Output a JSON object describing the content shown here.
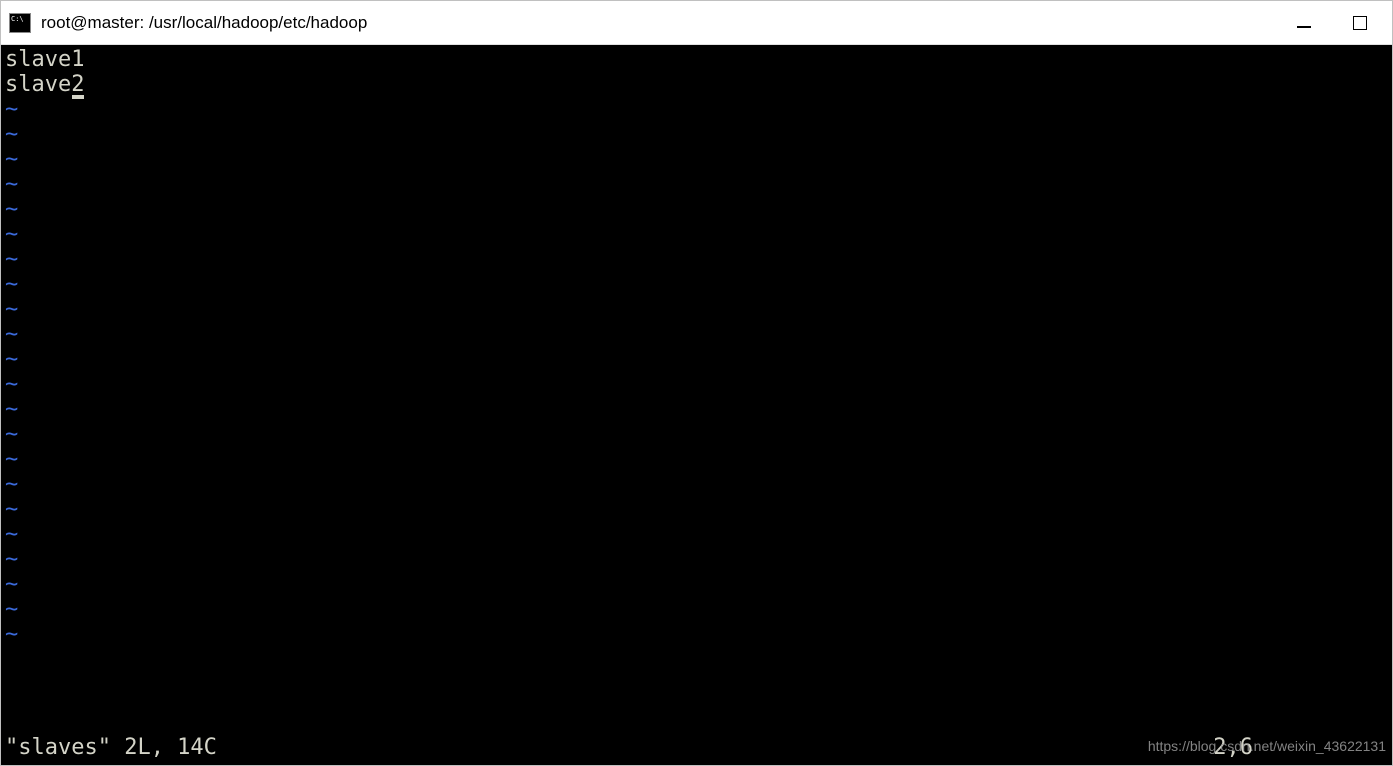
{
  "window": {
    "title": "root@master: /usr/local/hadoop/etc/hadoop"
  },
  "editor": {
    "lines": [
      "slave1",
      "slave2"
    ],
    "tilde_count": 22,
    "status": {
      "file_info": "\"slaves\" 2L, 14C",
      "cursor_pos": "2,6"
    }
  },
  "watermark": "https://blog.csdn.net/weixin_43622131"
}
